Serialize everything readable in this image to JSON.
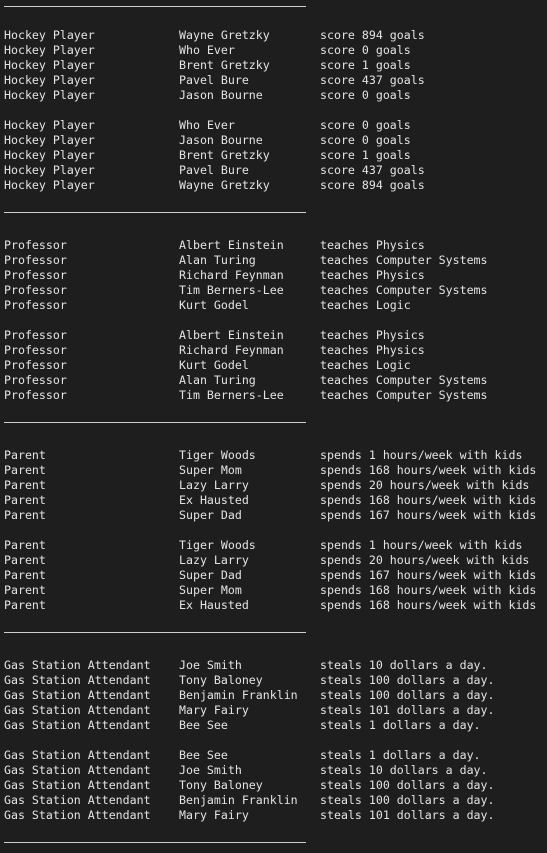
{
  "sections": [
    {
      "blocks": [
        [
          [
            "Hockey Player",
            "Wayne Gretzky",
            "score 894 goals"
          ],
          [
            "Hockey Player",
            "Who Ever",
            "score 0 goals"
          ],
          [
            "Hockey Player",
            "Brent Gretzky",
            "score 1 goals"
          ],
          [
            "Hockey Player",
            "Pavel Bure",
            "score 437 goals"
          ],
          [
            "Hockey Player",
            "Jason Bourne",
            "score 0 goals"
          ]
        ],
        [
          [
            "Hockey Player",
            "Who Ever",
            "score 0 goals"
          ],
          [
            "Hockey Player",
            "Jason Bourne",
            "score 0 goals"
          ],
          [
            "Hockey Player",
            "Brent Gretzky",
            "score 1 goals"
          ],
          [
            "Hockey Player",
            "Pavel Bure",
            "score 437 goals"
          ],
          [
            "Hockey Player",
            "Wayne Gretzky",
            "score 894 goals"
          ]
        ]
      ]
    },
    {
      "blocks": [
        [
          [
            "Professor",
            "Albert Einstein",
            "teaches Physics"
          ],
          [
            "Professor",
            "Alan Turing",
            "teaches Computer Systems"
          ],
          [
            "Professor",
            "Richard Feynman",
            "teaches Physics"
          ],
          [
            "Professor",
            "Tim Berners-Lee",
            "teaches Computer Systems"
          ],
          [
            "Professor",
            "Kurt Godel",
            "teaches Logic"
          ]
        ],
        [
          [
            "Professor",
            "Albert Einstein",
            "teaches Physics"
          ],
          [
            "Professor",
            "Richard Feynman",
            "teaches Physics"
          ],
          [
            "Professor",
            "Kurt Godel",
            "teaches Logic"
          ],
          [
            "Professor",
            "Alan Turing",
            "teaches Computer Systems"
          ],
          [
            "Professor",
            "Tim Berners-Lee",
            "teaches Computer Systems"
          ]
        ]
      ]
    },
    {
      "blocks": [
        [
          [
            "Parent",
            "Tiger Woods",
            "spends 1 hours/week with kids"
          ],
          [
            "Parent",
            "Super Mom",
            "spends 168 hours/week with kids"
          ],
          [
            "Parent",
            "Lazy Larry",
            "spends 20 hours/week with kids"
          ],
          [
            "Parent",
            "Ex Hausted",
            "spends 168 hours/week with kids"
          ],
          [
            "Parent",
            "Super Dad",
            "spends 167 hours/week with kids"
          ]
        ],
        [
          [
            "Parent",
            "Tiger Woods",
            "spends 1 hours/week with kids"
          ],
          [
            "Parent",
            "Lazy Larry",
            "spends 20 hours/week with kids"
          ],
          [
            "Parent",
            "Super Dad",
            "spends 167 hours/week with kids"
          ],
          [
            "Parent",
            "Super Mom",
            "spends 168 hours/week with kids"
          ],
          [
            "Parent",
            "Ex Hausted",
            "spends 168 hours/week with kids"
          ]
        ]
      ]
    },
    {
      "blocks": [
        [
          [
            "Gas Station Attendant",
            "Joe Smith",
            "steals 10 dollars a day."
          ],
          [
            "Gas Station Attendant",
            "Tony Baloney",
            "steals 100 dollars a day."
          ],
          [
            "Gas Station Attendant",
            "Benjamin Franklin",
            "steals 100 dollars a day."
          ],
          [
            "Gas Station Attendant",
            "Mary Fairy",
            "steals 101 dollars a day."
          ],
          [
            "Gas Station Attendant",
            "Bee See",
            "steals 1 dollars a day."
          ]
        ],
        [
          [
            "Gas Station Attendant",
            "Bee See",
            "steals 1 dollars a day."
          ],
          [
            "Gas Station Attendant",
            "Joe Smith",
            "steals 10 dollars a day."
          ],
          [
            "Gas Station Attendant",
            "Tony Baloney",
            "steals 100 dollars a day."
          ],
          [
            "Gas Station Attendant",
            "Benjamin Franklin",
            "steals 100 dollars a day."
          ],
          [
            "Gas Station Attendant",
            "Mary Fairy",
            "steals 101 dollars a day."
          ]
        ]
      ]
    }
  ]
}
